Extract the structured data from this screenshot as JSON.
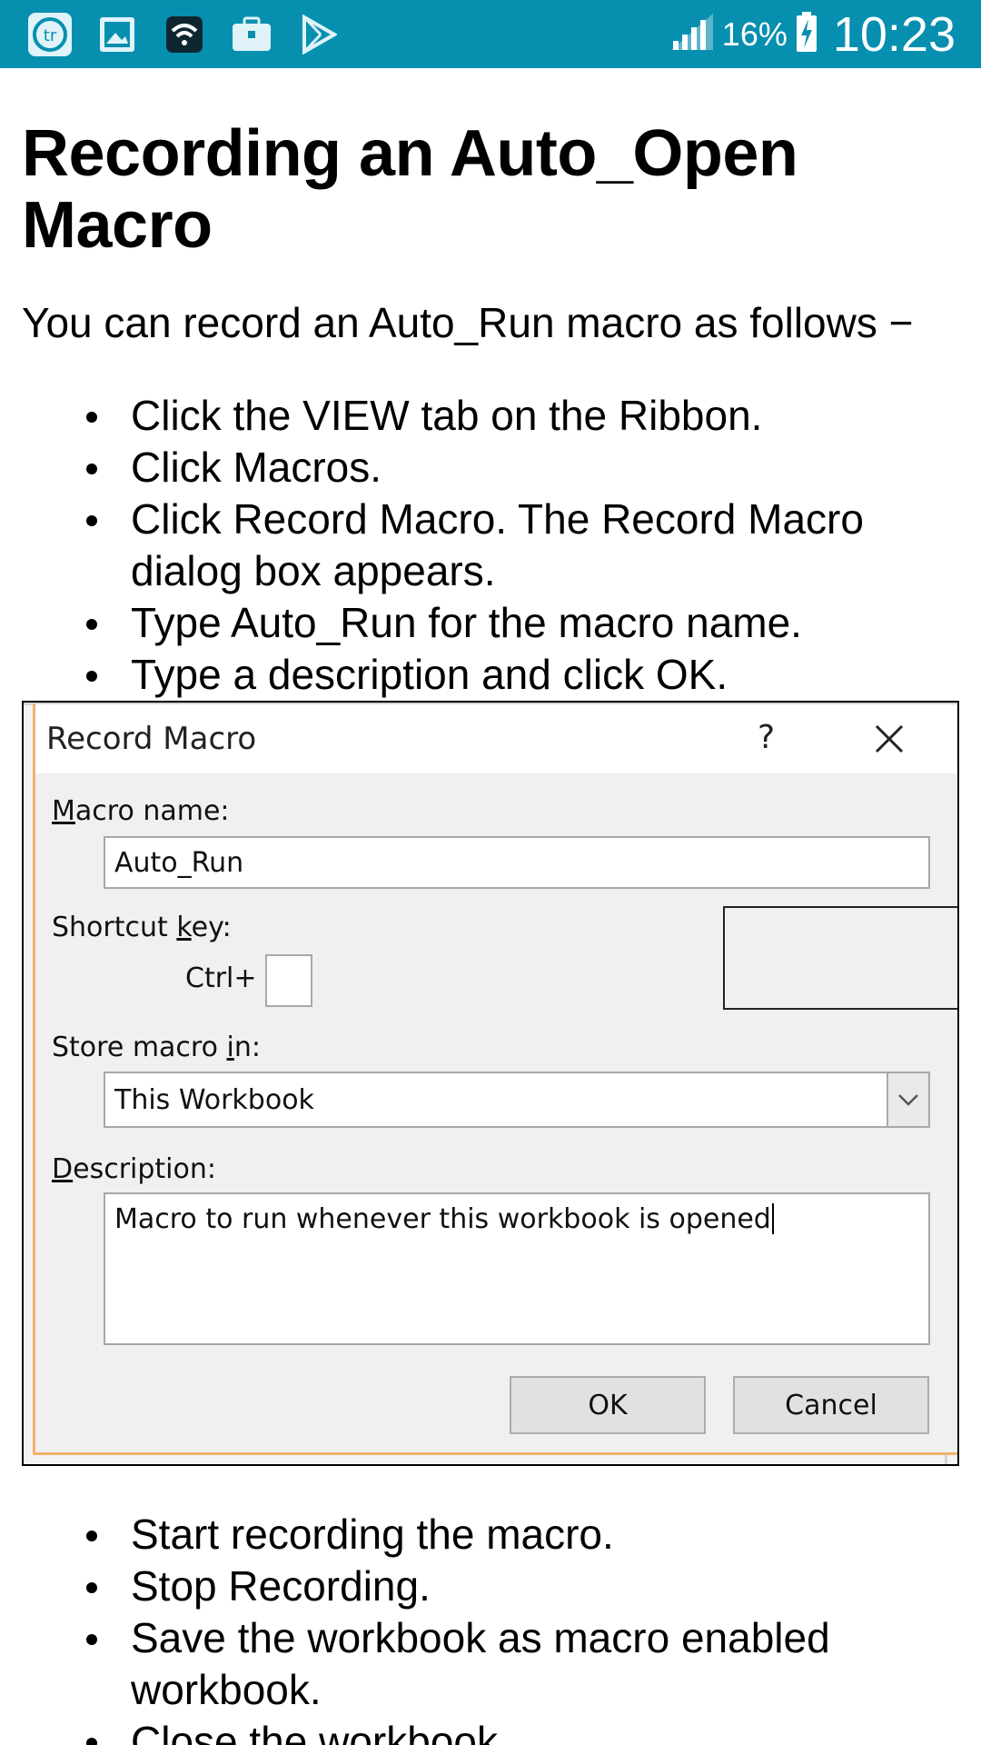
{
  "status_bar": {
    "icons": [
      "tr-app-icon",
      "gallery-icon",
      "wifi-icon",
      "briefcase-icon",
      "play-store-icon"
    ],
    "signal_icon": "signal-icon",
    "battery_percent": "16%",
    "battery_icon": "battery-charging-icon",
    "time": "10:23",
    "background_color": "#078fb0"
  },
  "article": {
    "title": "Recording an Auto_Open Macro",
    "intro": "You can record an Auto_Run macro as follows −",
    "steps": [
      "Click the VIEW tab on the Ribbon.",
      "Click Macros.",
      "Click Record Macro. The Record Macro dialog box appears.",
      "Type Auto_Run for the macro name.",
      "Type a description and click OK."
    ],
    "steps_after": [
      "Start recording the macro.",
      "Stop Recording.",
      "Save the workbook as macro enabled workbook.",
      "Close the workbook."
    ]
  },
  "dialog": {
    "title": "Record Macro",
    "help": "?",
    "macro_name_label_first": "M",
    "macro_name_label_rest": "acro name:",
    "macro_name_value": "Auto_Run",
    "shortcut_label_start": "Shortcut ",
    "shortcut_label_u": "k",
    "shortcut_label_end": "ey:",
    "ctrl_label": "Ctrl+",
    "shortcut_value": "",
    "store_label_start": "Store macro ",
    "store_label_u": "i",
    "store_label_end": "n:",
    "store_value": "This Workbook",
    "description_label_first": "D",
    "description_label_rest": "escription:",
    "description_value": "Macro to run whenever this workbook is opened",
    "ok_label": "OK",
    "cancel_label": "Cancel"
  }
}
